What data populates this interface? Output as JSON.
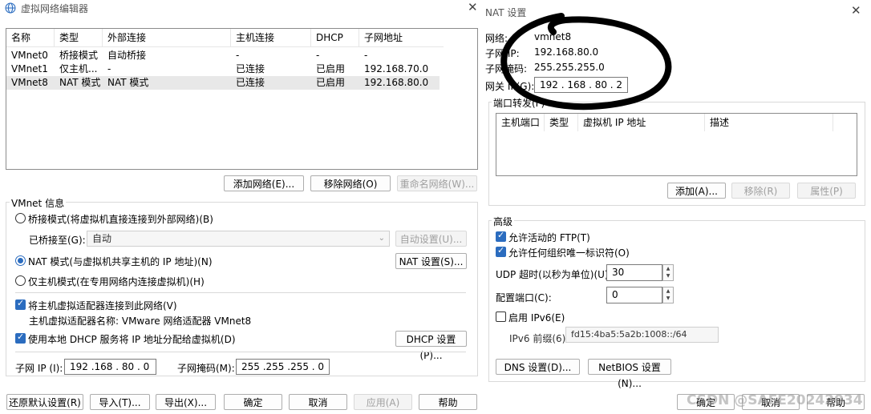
{
  "left_dialog": {
    "title": "虚拟网络编辑器",
    "close_icon": "close-icon",
    "app_icon": "globe-icon",
    "table": {
      "headers": [
        "名称",
        "类型",
        "外部连接",
        "主机连接",
        "DHCP",
        "子网地址"
      ],
      "rows": [
        [
          "VMnet0",
          "桥接模式",
          "自动桥接",
          "-",
          "-",
          "-"
        ],
        [
          "VMnet1",
          "仅主机...",
          "-",
          "已连接",
          "已启用",
          "192.168.70.0"
        ],
        [
          "VMnet8",
          "NAT 模式",
          "NAT 模式",
          "已连接",
          "已启用",
          "192.168.80.0"
        ]
      ],
      "selected_row": 2
    },
    "add_network": "添加网络(E)...",
    "remove_network": "移除网络(O)",
    "rename_network": "重命名网络(W)...",
    "vmnet_info": "VMnet 信息",
    "bridged_mode": "桥接模式(将虚拟机直接连接到外部网络)(B)",
    "bridged_to_label": "已桥接至(G):",
    "bridged_to_value": "自动",
    "auto_settings": "自动设置(U)...",
    "nat_mode": "NAT 模式(与虚拟机共享主机的 IP 地址)(N)",
    "nat_settings": "NAT 设置(S)...",
    "host_only_mode": "仅主机模式(在专用网络内连接虚拟机)(H)",
    "connect_adapter": "将主机虚拟适配器连接到此网络(V)",
    "adapter_name": "主机虚拟适配器名称: VMware 网络适配器 VMnet8",
    "use_dhcp": "使用本地 DHCP 服务将 IP 地址分配给虚拟机(D)",
    "dhcp_settings": "DHCP 设置(P)...",
    "subnet_ip_label": "子网 IP (I):",
    "subnet_ip_value": "192 .168 . 80  .  0",
    "subnet_mask_label": "子网掩码(M):",
    "subnet_mask_value": "255 .255 .255 .  0",
    "restore_defaults": "还原默认设置(R)",
    "import": "导入(T)...",
    "export": "导出(X)...",
    "ok": "确定",
    "cancel": "取消",
    "apply": "应用(A)",
    "help": "帮助"
  },
  "right_dialog": {
    "title": "NAT 设置",
    "close_icon": "close-icon",
    "network_label": "网络:",
    "network_value": "vmnet8",
    "subnet_ip_label": "子网 IP:",
    "subnet_ip_value": "192.168.80.0",
    "subnet_mask_label": "子网掩码:",
    "subnet_mask_value": "255.255.255.0",
    "gateway_label": "网关 IP(G):",
    "gateway_value": "192 . 168 . 80  .  2",
    "port_forwarding": "端口转发(F)",
    "pf_headers": [
      "主机端口",
      "类型",
      "虚拟机 IP 地址",
      "描述"
    ],
    "add": "添加(A)...",
    "remove": "移除(R)",
    "properties": "属性(P)",
    "advanced": "高级",
    "allow_ftp": "允许活动的 FTP(T)",
    "allow_oui": "允许任何组织唯一标识符(O)",
    "udp_timeout_label": "UDP 超时(以秒为单位)(U):",
    "udp_timeout_value": "30",
    "config_port_label": "配置端口(C):",
    "config_port_value": "0",
    "enable_ipv6": "启用 IPv6(E)",
    "ipv6_prefix_label": "IPv6 前缀(6):",
    "ipv6_prefix_value": "fd15:4ba5:5a2b:1008::/64",
    "dns_settings": "DNS 设置(D)...",
    "netbios_settings": "NetBIOS 设置(N)...",
    "ok": "确定",
    "cancel": "取消",
    "help": "帮助"
  },
  "watermark": "CSDN @SAFE20242034",
  "annotation_color": "#000000",
  "accent_color": "#2b6cbf"
}
